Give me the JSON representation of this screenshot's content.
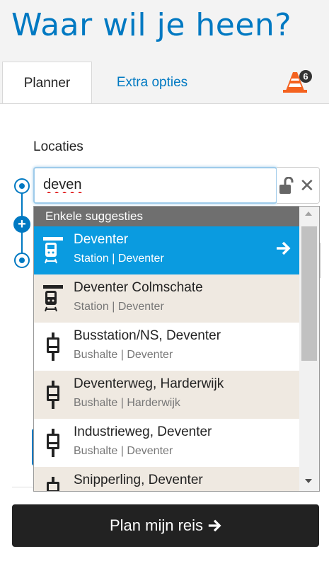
{
  "page": {
    "title": "Waar wil je heen?"
  },
  "tabs": {
    "planner": "Planner",
    "extra": "Extra opties"
  },
  "warnings": {
    "count": "6",
    "icon": "traffic-cone-icon"
  },
  "locations": {
    "label": "Locaties",
    "input_value": "deven"
  },
  "suggestions": {
    "header": "Enkele suggesties",
    "items": [
      {
        "name": "Deventer",
        "sub": "Station | Deventer",
        "icon": "train-icon"
      },
      {
        "name": "Deventer Colmschate",
        "sub": "Station | Deventer",
        "icon": "train-icon"
      },
      {
        "name": "Busstation/NS, Deventer",
        "sub": "Bushalte | Deventer",
        "icon": "bus-stop-icon"
      },
      {
        "name": "Deventerweg, Harderwijk",
        "sub": "Bushalte | Harderwijk",
        "icon": "bus-stop-icon"
      },
      {
        "name": "Industrieweg, Deventer",
        "sub": "Bushalte | Deventer",
        "icon": "bus-stop-icon"
      },
      {
        "name": "Snipperling, Deventer",
        "sub": "",
        "icon": "bus-stop-icon"
      }
    ]
  },
  "actions": {
    "plan": "Plan mijn reis"
  },
  "colors": {
    "brand_blue": "#0079c2",
    "selected": "#0a9be0",
    "alt_row": "#efe9e1",
    "cone": "#f4621f"
  }
}
